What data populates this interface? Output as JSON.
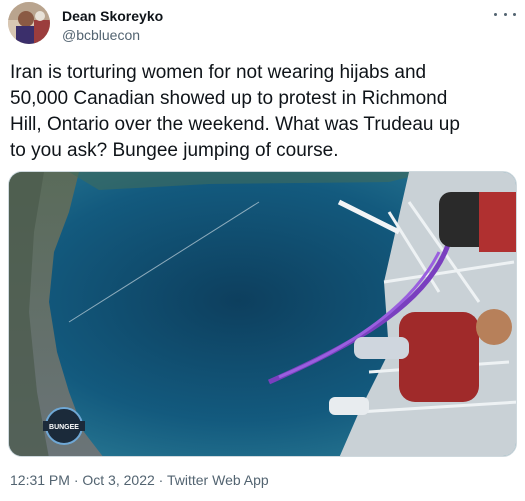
{
  "author": {
    "name": "Dean Skoreyko",
    "handle": "@bcbluecon"
  },
  "tweet": {
    "text": "Iran is torturing women for not wearing hijabs and\n50,000 Canadian showed up to protest in Richmond\nHill, Ontario over the weekend. What was Trudeau up\nto you ask? Bungee jumping of course."
  },
  "media": {
    "watermark": "BUNGEE"
  },
  "meta": {
    "time": "12:31 PM",
    "date": "Oct 3, 2022",
    "source": "Twitter Web App",
    "separator": " · "
  },
  "icons": {
    "more": "more-icon"
  }
}
